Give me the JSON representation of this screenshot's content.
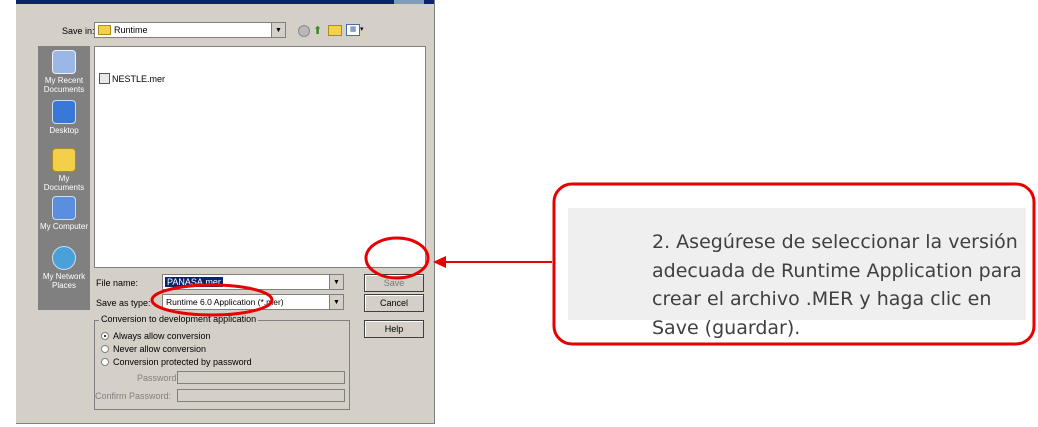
{
  "dialog": {
    "save_in_label": "Save in:",
    "save_in_value": "Runtime",
    "places": [
      "My Recent Documents",
      "Desktop",
      "My Documents",
      "My Computer",
      "My Network Places"
    ],
    "files": [
      "NESTLE.mer"
    ],
    "file_name_label": "File name:",
    "file_name_value": "PANASA.mer",
    "save_as_type_label": "Save as type:",
    "save_as_type_value": "Runtime 6.0 Application (*.mer)",
    "save_button": "Save",
    "cancel_button": "Cancel",
    "help_button": "Help",
    "conversion_group_label": "Conversion to development application",
    "conversion_options": [
      "Always allow conversion",
      "Never allow conversion",
      "Conversion protected by password"
    ],
    "password_label": "Password:",
    "confirm_password_label": "Confirm Password:"
  },
  "callout": {
    "text": "2. Asegúrese de seleccionar la versión adecuada de Runtime Application para crear el archivo .MER y haga clic en Save (guardar)."
  },
  "colors": {
    "annotation_red": "#e60000",
    "callout_text": "#404040",
    "selection_blue": "#0a246a",
    "dialog_gray": "#d4d0c8",
    "places_bar": "#808080"
  }
}
